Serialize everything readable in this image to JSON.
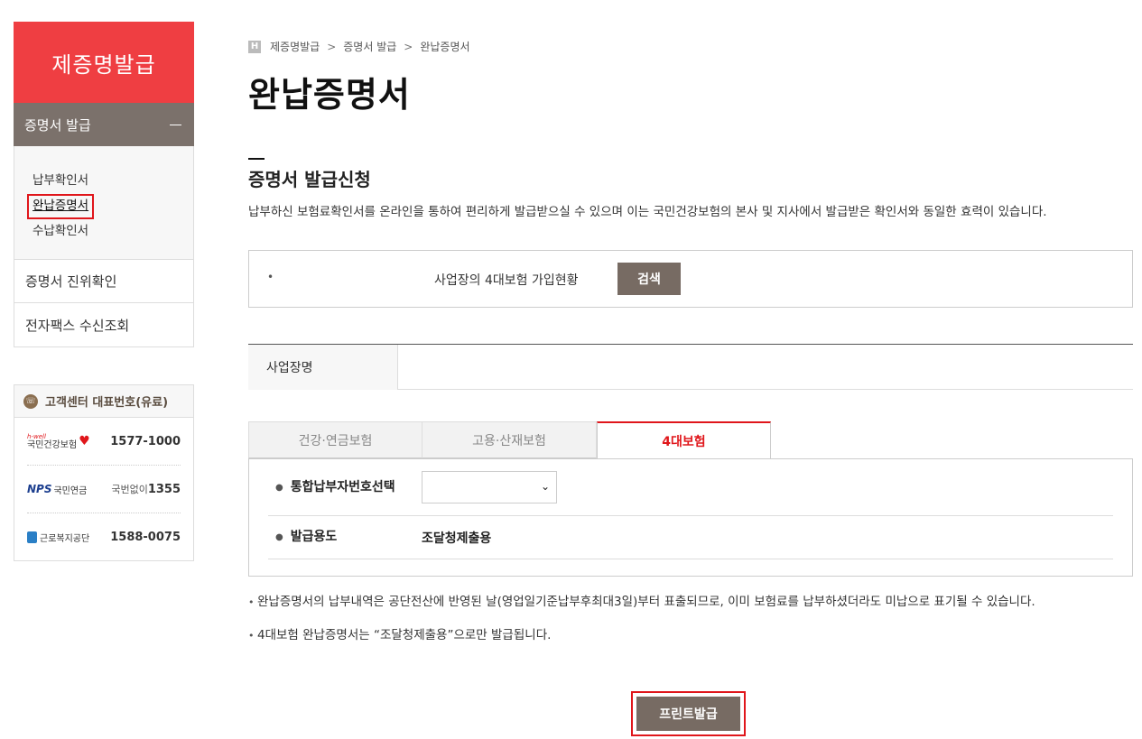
{
  "sidebar": {
    "title": "제증명발급",
    "group_label": "증명서 발급",
    "sub_items": [
      "납부확인서",
      "완납증명서",
      "수납확인서"
    ],
    "menu_items": [
      "증명서 진위확인",
      "전자팩스 수신조회"
    ]
  },
  "customer_center": {
    "title": "고객센터 대표번호(유료)",
    "rows": [
      {
        "org": "국민건강보험",
        "org_tag": "h-well",
        "number": "1577-1000",
        "prefix": ""
      },
      {
        "org": "국민연금",
        "org_tag": "NPS",
        "number": "1355",
        "prefix": "국번없이"
      },
      {
        "org": "근로복지공단",
        "org_tag": "",
        "number": "1588-0075",
        "prefix": ""
      }
    ]
  },
  "breadcrumb": [
    "제증명발급",
    "증명서 발급",
    "완납증명서"
  ],
  "breadcrumb_sep": ">",
  "page_title": "완납증명서",
  "section": {
    "title": "증명서 발급신청",
    "description": "납부하신 보험료확인서를 온라인을 통하여 편리하게 발급받으실 수 있으며 이는 국민건강보험의 본사 및 지사에서 발급받은 확인서와 동일한 효력이 있습니다."
  },
  "search": {
    "bullet": "•",
    "label": "사업장의 4대보험 가입현황",
    "button": "검색"
  },
  "business": {
    "label": "사업장명",
    "value": ""
  },
  "tabs": [
    {
      "label": "건강·연금보험",
      "active": false
    },
    {
      "label": "고용·산재보험",
      "active": false
    },
    {
      "label": "4대보험",
      "active": true
    }
  ],
  "form": {
    "payer_label": "통합납부자번호선택",
    "payer_selected": "",
    "purpose_label": "발급용도",
    "purpose_value": "조달청제출용"
  },
  "notes": [
    "완납증명서의 납부내역은 공단전산에 반영된 날(영업일기준납부후최대3일)부터 표출되므로, 이미 보험료를 납부하셨더라도 미납으로 표기될 수 있습니다.",
    "4대보험 완납증명서는 “조달청제출용”으로만 발급됩니다."
  ],
  "print_button": "프린트발급",
  "colors": {
    "accent_red": "#ef3e42",
    "brown_button": "#776b63",
    "sidebar_group": "#7b716b"
  }
}
